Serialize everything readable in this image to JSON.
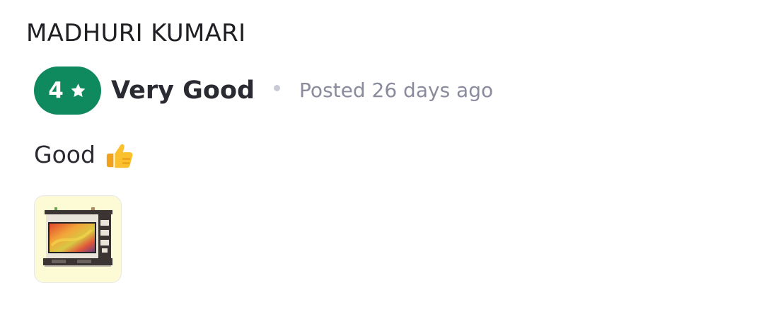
{
  "review": {
    "reviewer_name": "MADHURI KUMARI",
    "rating_value": "4",
    "rating_label": "Very Good",
    "posted_text": "Posted 26 days ago",
    "review_text": "Good",
    "badge_color": "#0f8a5f",
    "icons": {
      "rating": "star-icon",
      "emoji": "thumbs-up-icon"
    },
    "image": {
      "description": "product-photo-tv-unit"
    }
  }
}
